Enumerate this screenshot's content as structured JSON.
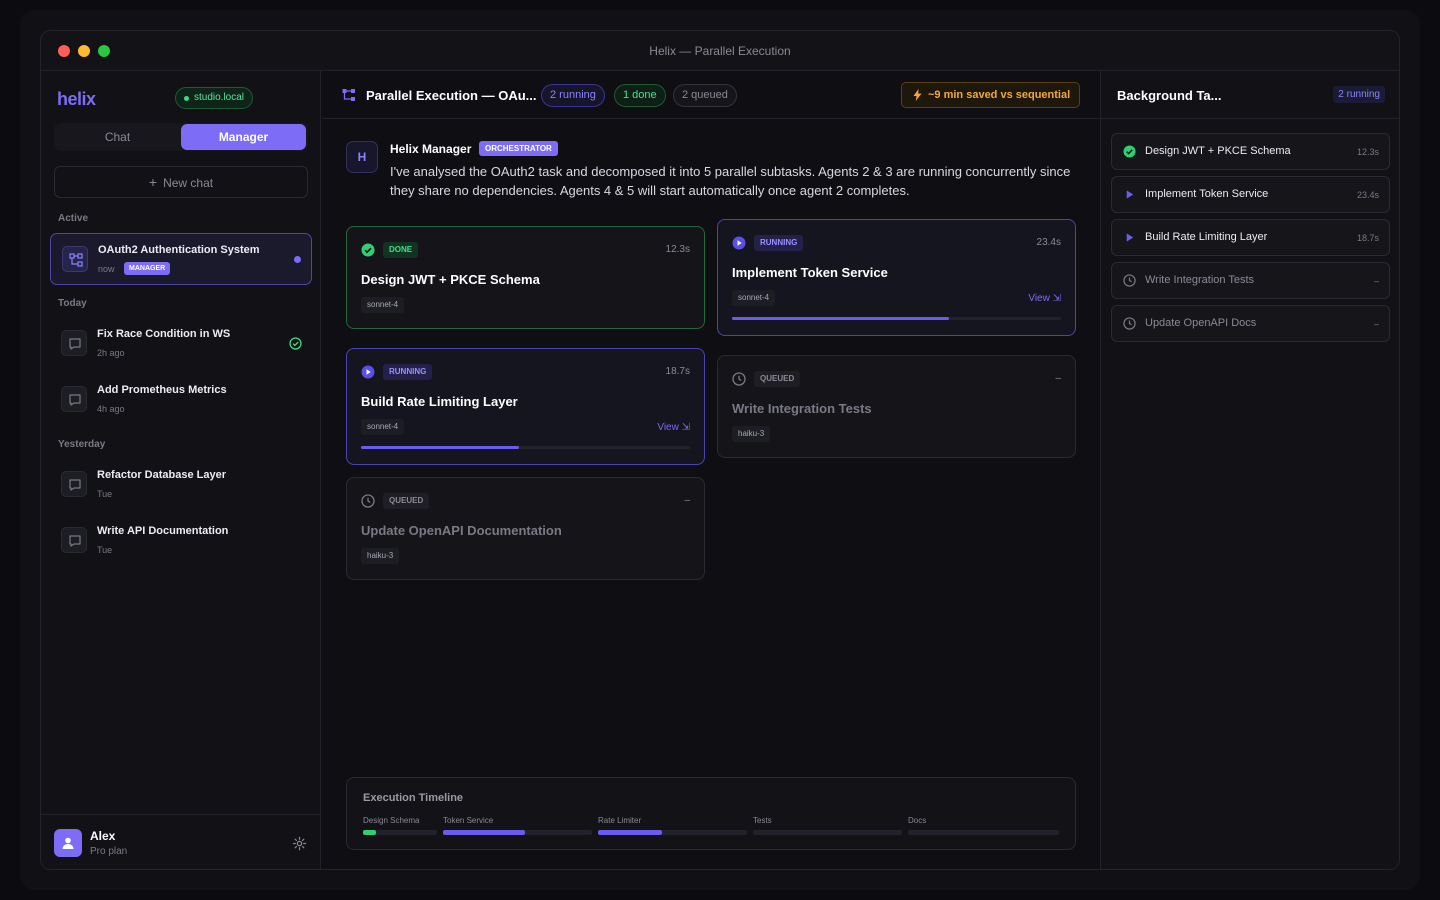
{
  "window": {
    "title": "Helix — Parallel Execution"
  },
  "sidebar": {
    "logo": "helix",
    "server": "studio.local",
    "modes": {
      "chat": "Chat",
      "manager": "Manager"
    },
    "new_chat": "New chat",
    "sections": {
      "active": "Active",
      "today": "Today",
      "yesterday": "Yesterday"
    },
    "active_item": {
      "title": "OAuth2 Authentication System",
      "time": "now",
      "tag": "MANAGER"
    },
    "today": [
      {
        "title": "Fix Race Condition in WS",
        "time": "2h ago",
        "status": "done"
      },
      {
        "title": "Add Prometheus Metrics",
        "time": "4h ago"
      }
    ],
    "yesterday": [
      {
        "title": "Refactor Database Layer",
        "time": "Tue"
      },
      {
        "title": "Write API Documentation",
        "time": "Tue"
      }
    ],
    "user": {
      "name": "Alex",
      "plan": "Pro plan"
    }
  },
  "main": {
    "title": "Parallel Execution — OAu...",
    "pills": {
      "running": "2 running",
      "done": "1 done",
      "queued": "2 queued"
    },
    "saved": "~9 min saved vs sequential",
    "message": {
      "avatar": "H",
      "sender": "Helix Manager",
      "tag": "ORCHESTRATOR",
      "text": "I've analysed the OAuth2 task and decomposed it into 5 parallel subtasks. Agents 2 & 3 are running concurrently since they share no dependencies. Agents 4 & 5 will start automatically once agent 2 completes."
    },
    "cards": [
      {
        "status": "DONE",
        "title": "Design JWT + PKCE Schema",
        "duration": "12.3s",
        "model": "sonnet-4"
      },
      {
        "status": "RUNNING",
        "title": "Implement Token Service",
        "duration": "23.4s",
        "model": "sonnet-4",
        "view": "View ⇲",
        "progress": 0.66
      },
      {
        "status": "RUNNING",
        "title": "Build Rate Limiting Layer",
        "duration": "18.7s",
        "model": "sonnet-4",
        "view": "View ⇲",
        "progress": 0.48
      },
      {
        "status": "QUEUED",
        "title": "Write Integration Tests",
        "duration": "–",
        "model": "haiku-3"
      },
      {
        "status": "QUEUED",
        "title": "Update OpenAPI Documentation",
        "duration": "–",
        "model": "haiku-3"
      }
    ],
    "timeline": {
      "title": "Execution Timeline",
      "segments": [
        {
          "label": "Design Schema",
          "progress": 0.17,
          "color": "#2fcf72"
        },
        {
          "label": "Token Service",
          "progress": 0.55,
          "color": "#6a5cf0"
        },
        {
          "label": "Rate Limiter",
          "progress": 0.43,
          "color": "#6a5cf0"
        },
        {
          "label": "Tests",
          "progress": 0,
          "color": "#6a5cf0"
        },
        {
          "label": "Docs",
          "progress": 0,
          "color": "#6a5cf0"
        }
      ]
    }
  },
  "right_panel": {
    "title": "Background Ta...",
    "badge": "2 running",
    "tasks": [
      {
        "title": "Design JWT + PKCE Schema",
        "time": "12.3s",
        "status": "done"
      },
      {
        "title": "Implement Token Service",
        "time": "23.4s",
        "status": "running"
      },
      {
        "title": "Build Rate Limiting Layer",
        "time": "18.7s",
        "status": "running"
      },
      {
        "title": "Write Integration Tests",
        "time": "–",
        "status": "queued"
      },
      {
        "title": "Update OpenAPI Docs",
        "time": "–",
        "status": "queued"
      }
    ]
  },
  "colors": {
    "accent": "#7c6cf6",
    "success": "#3ddc84",
    "warning": "#f3a83b"
  }
}
